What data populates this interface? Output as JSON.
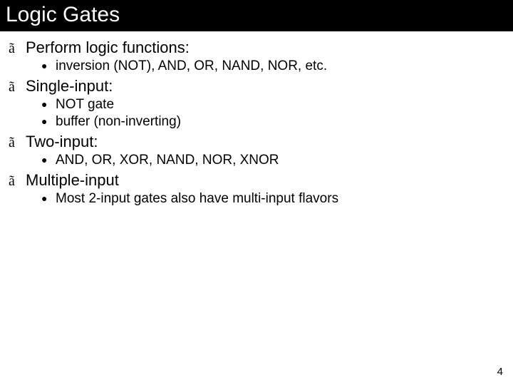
{
  "slide": {
    "title": "Logic Gates",
    "page_number": "4",
    "bullets": {
      "lvl1_glyph": "ã",
      "lvl2_glyph": "●"
    },
    "items": [
      {
        "text": "Perform logic functions:",
        "sub": [
          "inversion (NOT), AND, OR, NAND, NOR, etc."
        ]
      },
      {
        "text": "Single-input:",
        "sub": [
          "NOT gate",
          "buffer (non-inverting)"
        ]
      },
      {
        "text": "Two-input:",
        "sub": [
          "AND, OR, XOR, NAND, NOR, XNOR"
        ]
      },
      {
        "text": "Multiple-input",
        "sub": [
          "Most 2-input gates also have multi-input flavors"
        ]
      }
    ]
  }
}
